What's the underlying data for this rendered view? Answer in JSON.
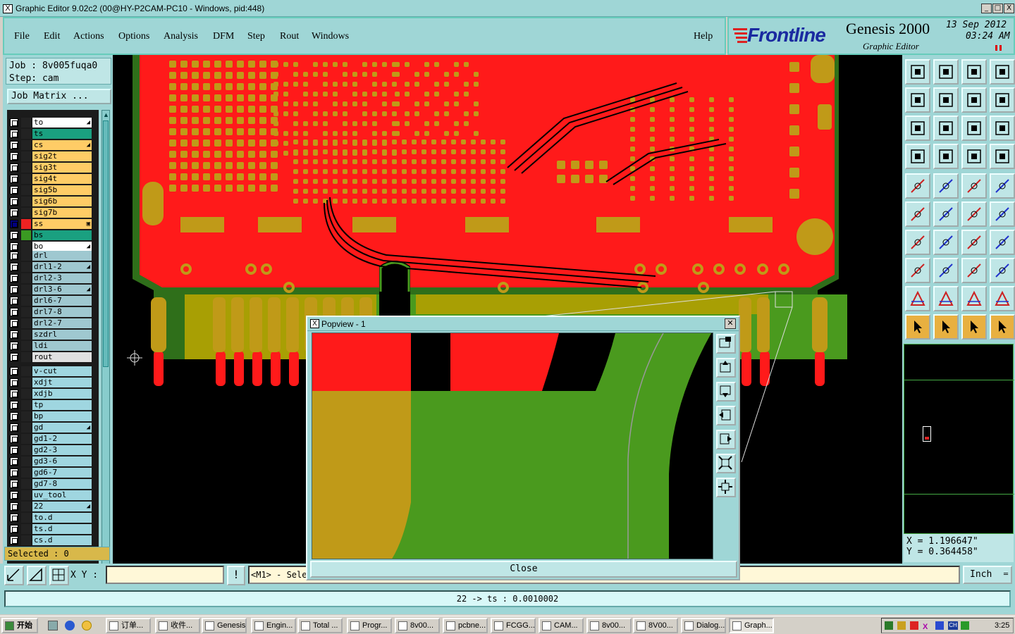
{
  "window": {
    "title": "Graphic Editor 9.02c2 (00@HY-P2CAM-PC10 - Windows, pid:448)",
    "min": "_",
    "max": "□",
    "close": "X"
  },
  "menu": [
    "File",
    "Edit",
    "Actions",
    "Options",
    "Analysis",
    "DFM",
    "Step",
    "Rout",
    "Windows"
  ],
  "help": "Help",
  "brand": {
    "company": "Frontline",
    "product": "Genesis 2000",
    "subtitle": "Graphic Editor",
    "date": "13 Sep 2012",
    "time": "03:24 AM"
  },
  "job": {
    "job_line": "Job : 8v005fuqa0",
    "step_line": "Step: cam",
    "matrix_button": "Job Matrix ..."
  },
  "layers": [
    {
      "name": "to",
      "color": "#ffffff",
      "swatch": "#222",
      "mark": "◢"
    },
    {
      "name": "ts",
      "color": "#1aa080",
      "swatch": "#222",
      "mark": ""
    },
    {
      "name": "cs",
      "color": "#ffcc66",
      "swatch": "#222",
      "mark": "◢"
    },
    {
      "name": "sig2t",
      "color": "#ffcc66",
      "swatch": "#222",
      "mark": ""
    },
    {
      "name": "sig3t",
      "color": "#ffcc66",
      "swatch": "#222",
      "mark": ""
    },
    {
      "name": "sig4t",
      "color": "#ffcc66",
      "swatch": "#222",
      "mark": ""
    },
    {
      "name": "sig5b",
      "color": "#ffcc66",
      "swatch": "#222",
      "mark": ""
    },
    {
      "name": "sig6b",
      "color": "#ffcc66",
      "swatch": "#222",
      "mark": ""
    },
    {
      "name": "sig7b",
      "color": "#ffcc66",
      "swatch": "#222",
      "mark": ""
    },
    {
      "name": "ss",
      "color": "#ffcc66",
      "swatch": "#ee2222",
      "mark": "▣",
      "checked": true
    },
    {
      "name": "bs",
      "color": "#1aa080",
      "swatch": "#3a9a22",
      "mark": ""
    },
    {
      "name": "bo",
      "color": "#ffffff",
      "swatch": "#222",
      "mark": "◢"
    },
    {
      "name": "drl",
      "color": "#9fc8d0",
      "swatch": "#222",
      "mark": ""
    },
    {
      "name": "drl1-2",
      "color": "#9fc8d0",
      "swatch": "#222",
      "mark": "◢"
    },
    {
      "name": "drl2-3",
      "color": "#9fc8d0",
      "swatch": "#222",
      "mark": ""
    },
    {
      "name": "drl3-6",
      "color": "#9fc8d0",
      "swatch": "#222",
      "mark": "◢"
    },
    {
      "name": "drl6-7",
      "color": "#9fc8d0",
      "swatch": "#222",
      "mark": ""
    },
    {
      "name": "drl7-8",
      "color": "#9fc8d0",
      "swatch": "#222",
      "mark": ""
    },
    {
      "name": "drl2-7",
      "color": "#9fc8d0",
      "swatch": "#222",
      "mark": ""
    },
    {
      "name": "szdrl",
      "color": "#9fc8d0",
      "swatch": "#222",
      "mark": ""
    },
    {
      "name": "ldi",
      "color": "#9fc8d0",
      "swatch": "#222",
      "mark": ""
    },
    {
      "name": "rout",
      "color": "#e0e0e0",
      "swatch": "#222",
      "mark": ""
    },
    {
      "name": "v-cut",
      "color": "#9fd6e0",
      "swatch": "#222",
      "mark": ""
    },
    {
      "name": "xdjt",
      "color": "#9fd6e0",
      "swatch": "#222",
      "mark": ""
    },
    {
      "name": "xdjb",
      "color": "#9fd6e0",
      "swatch": "#222",
      "mark": ""
    },
    {
      "name": "tp",
      "color": "#9fd6e0",
      "swatch": "#222",
      "mark": ""
    },
    {
      "name": "bp",
      "color": "#9fd6e0",
      "swatch": "#222",
      "mark": ""
    },
    {
      "name": "gd",
      "color": "#9fd6e0",
      "swatch": "#222",
      "mark": "◢"
    },
    {
      "name": "gd1-2",
      "color": "#9fd6e0",
      "swatch": "#222",
      "mark": ""
    },
    {
      "name": "gd2-3",
      "color": "#9fd6e0",
      "swatch": "#222",
      "mark": ""
    },
    {
      "name": "gd3-6",
      "color": "#9fd6e0",
      "swatch": "#222",
      "mark": ""
    },
    {
      "name": "gd6-7",
      "color": "#9fd6e0",
      "swatch": "#222",
      "mark": ""
    },
    {
      "name": "gd7-8",
      "color": "#9fd6e0",
      "swatch": "#222",
      "mark": ""
    },
    {
      "name": "uv_tool",
      "color": "#9fd6e0",
      "swatch": "#222",
      "mark": ""
    },
    {
      "name": "22",
      "color": "#9fd6e0",
      "swatch": "#222",
      "mark": "◢"
    },
    {
      "name": "to.d",
      "color": "#9fd6e0",
      "swatch": "#222",
      "mark": ""
    },
    {
      "name": "ts.d",
      "color": "#9fd6e0",
      "swatch": "#222",
      "mark": ""
    },
    {
      "name": "cs.d",
      "color": "#9fd6e0",
      "swatch": "#222",
      "mark": ""
    }
  ],
  "selected": "Selected : 0",
  "coords": {
    "x": "X = 1.196647\"",
    "y": "Y = 0.364458\""
  },
  "command": {
    "xy_label": "X Y :",
    "xy_value": "",
    "bang": "!",
    "message": "<M1> - Sele",
    "unit": "Inch"
  },
  "status": "22 -> ts : 0.0010002",
  "popview": {
    "title": "Popview - 1",
    "close_label": "Close"
  },
  "taskbar": {
    "start": "开始",
    "items": [
      "订单...",
      "收件...",
      "Genesis",
      "Engin...",
      "Total ...",
      "Progr...",
      "8v00...",
      "pcbne...",
      "FCGG...",
      "CAM...",
      "8v00...",
      "8V00...",
      "Dialog...",
      "Graph..."
    ],
    "clock": "3:25"
  },
  "colors": {
    "panel": "#9fd6d6",
    "copper_red": "#ff1a1a",
    "gold": "#c09a18",
    "mask_green": "#4a9a1e"
  }
}
